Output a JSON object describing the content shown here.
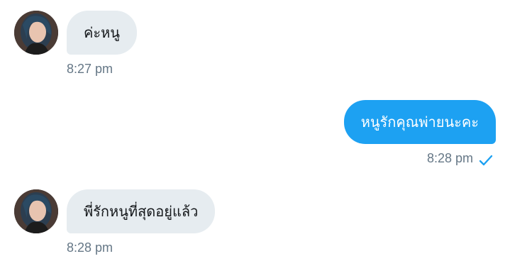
{
  "conversation": {
    "messages": [
      {
        "direction": "incoming",
        "text": "ค่ะหนู",
        "time": "8:27 pm",
        "avatar_icon": "user-avatar"
      },
      {
        "direction": "outgoing",
        "text": "หนูรักคุณพ่ายนะคะ",
        "time": "8:28 pm",
        "status_icon": "checkmark-icon"
      },
      {
        "direction": "incoming",
        "text": "พี่รักหนูที่สุดอยู่แล้ว",
        "time": "8:28 pm",
        "avatar_icon": "user-avatar"
      }
    ]
  },
  "colors": {
    "incoming_bubble": "#e6ecf0",
    "outgoing_bubble": "#1da1f2",
    "timestamp": "#657786",
    "check": "#1da1f2"
  }
}
